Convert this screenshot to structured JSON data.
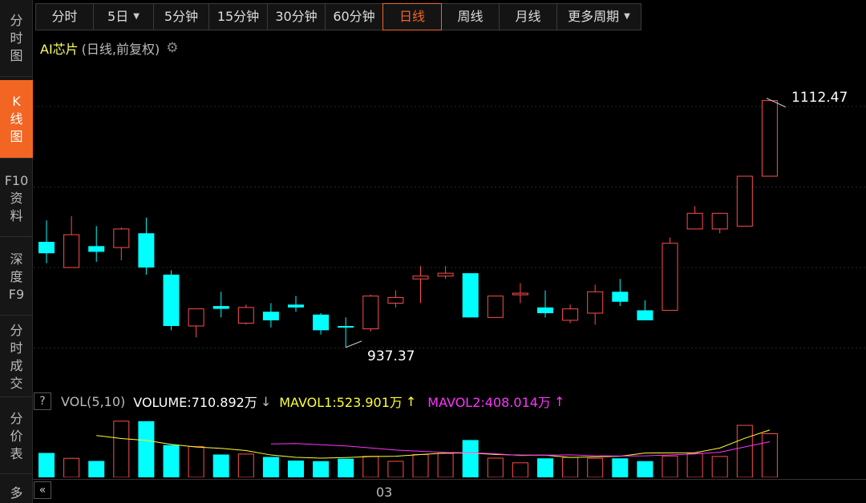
{
  "sidebar": {
    "items": [
      {
        "label": [
          "分",
          "时",
          "图"
        ],
        "active": false
      },
      {
        "label": [
          "K",
          "线",
          "图"
        ],
        "active": true
      },
      {
        "label": [
          "F10",
          "资",
          "料"
        ],
        "active": false
      },
      {
        "label": [
          "深",
          "度",
          "F9"
        ],
        "active": false
      },
      {
        "label": [
          "分",
          "时",
          "成",
          "交"
        ],
        "active": false
      },
      {
        "label": [
          "分",
          "价",
          "表"
        ],
        "active": false
      },
      {
        "label": [
          "多"
        ],
        "active": false
      }
    ]
  },
  "toolbar": {
    "tabs": [
      {
        "label": "分时",
        "dropdown": false
      },
      {
        "label": "5日",
        "dropdown": true
      },
      {
        "label": "5分钟",
        "dropdown": false
      },
      {
        "label": "15分钟",
        "dropdown": false
      },
      {
        "label": "30分钟",
        "dropdown": false
      },
      {
        "label": "60分钟",
        "dropdown": false
      },
      {
        "label": "日线",
        "dropdown": false,
        "active": true
      },
      {
        "label": "周线",
        "dropdown": false
      },
      {
        "label": "月线",
        "dropdown": false
      },
      {
        "label": "更多周期",
        "dropdown": true
      }
    ]
  },
  "chart_title": {
    "name": "AI芯片",
    "meta": "(日线,前复权)",
    "settings_icon": "gear-icon"
  },
  "price_annotations": {
    "high": "1112.47",
    "low": "937.37"
  },
  "volume_panel": {
    "help": "?",
    "label": "VOL(5,10)",
    "volume": "VOLUME:710.892万",
    "volume_arrow": "↓",
    "mavol1": "MAVOL1:523.901万",
    "mavol1_arrow": "↑",
    "mavol2": "MAVOL2:408.014万",
    "mavol2_arrow": "↑"
  },
  "x_axis": {
    "tick_label": "03"
  },
  "collapse_button": "«",
  "colors": {
    "up": "#ff4d4d",
    "down": "#00ffff",
    "ma1": "#ffff33",
    "ma2": "#ff33ff",
    "accent": "#f26522"
  },
  "chart_data": {
    "type": "candlestick",
    "price_ylim": [
      922,
      1132
    ],
    "candles": [
      {
        "o": 1013,
        "c": 1005,
        "h": 1028,
        "l": 998,
        "v": 263,
        "dir": "down"
      },
      {
        "o": 995,
        "c": 1018,
        "h": 1031,
        "l": 995,
        "v": 205,
        "dir": "up"
      },
      {
        "o": 1010,
        "c": 1006,
        "h": 1024,
        "l": 999,
        "v": 177,
        "dir": "down"
      },
      {
        "o": 1009,
        "c": 1022,
        "h": 1023,
        "l": 1000,
        "v": 605,
        "dir": "up"
      },
      {
        "o": 1019,
        "c": 995,
        "h": 1030,
        "l": 990,
        "v": 605,
        "dir": "down"
      },
      {
        "o": 990,
        "c": 954,
        "h": 993,
        "l": 951,
        "v": 348,
        "dir": "down"
      },
      {
        "o": 954,
        "c": 966,
        "h": 966,
        "l": 946,
        "v": 333,
        "dir": "up"
      },
      {
        "o": 968,
        "c": 966,
        "h": 978,
        "l": 960,
        "v": 246,
        "dir": "down"
      },
      {
        "o": 956,
        "c": 967,
        "h": 969,
        "l": 955,
        "v": 251,
        "dir": "up"
      },
      {
        "o": 964,
        "c": 958,
        "h": 970,
        "l": 953,
        "v": 220,
        "dir": "down"
      },
      {
        "o": 969,
        "c": 967,
        "h": 975,
        "l": 964,
        "v": 181,
        "dir": "down"
      },
      {
        "o": 962,
        "c": 951,
        "h": 963,
        "l": 948,
        "v": 175,
        "dir": "down"
      },
      {
        "o": 954,
        "c": 953,
        "h": 960,
        "l": 939,
        "v": 201,
        "dir": "down"
      },
      {
        "o": 952,
        "c": 975,
        "h": 976,
        "l": 950,
        "v": 227,
        "dir": "up"
      },
      {
        "o": 970,
        "c": 974,
        "h": 979,
        "l": 967,
        "v": 173,
        "dir": "up"
      },
      {
        "o": 987,
        "c": 989,
        "h": 996,
        "l": 970,
        "v": 246,
        "dir": "up"
      },
      {
        "o": 989,
        "c": 991,
        "h": 996,
        "l": 987,
        "v": 258,
        "dir": "up"
      },
      {
        "o": 991,
        "c": 960,
        "h": 991,
        "l": 960,
        "v": 402,
        "dir": "down"
      },
      {
        "o": 960,
        "c": 975,
        "h": 975,
        "l": 960,
        "v": 207,
        "dir": "up"
      },
      {
        "o": 976,
        "c": 977,
        "h": 984,
        "l": 970,
        "v": 157,
        "dir": "up"
      },
      {
        "o": 967,
        "c": 963,
        "h": 979,
        "l": 960,
        "v": 205,
        "dir": "down"
      },
      {
        "o": 958,
        "c": 966,
        "h": 969,
        "l": 956,
        "v": 215,
        "dir": "up"
      },
      {
        "o": 963,
        "c": 978,
        "h": 983,
        "l": 955,
        "v": 205,
        "dir": "up"
      },
      {
        "o": 978,
        "c": 971,
        "h": 987,
        "l": 968,
        "v": 205,
        "dir": "down"
      },
      {
        "o": 965,
        "c": 958,
        "h": 972,
        "l": 958,
        "v": 175,
        "dir": "down"
      },
      {
        "o": 965,
        "c": 1012,
        "h": 1016,
        "l": 965,
        "v": 230,
        "dir": "up"
      },
      {
        "o": 1022,
        "c": 1033,
        "h": 1038,
        "l": 1022,
        "v": 258,
        "dir": "up"
      },
      {
        "o": 1022,
        "c": 1033,
        "h": 1033,
        "l": 1019,
        "v": 225,
        "dir": "up"
      },
      {
        "o": 1024,
        "c": 1059,
        "h": 1059,
        "l": 1024,
        "v": 560,
        "dir": "up"
      },
      {
        "o": 1059,
        "c": 1112,
        "h": 1112,
        "l": 1059,
        "v": 470,
        "dir": "up"
      }
    ],
    "vol_ylim": [
      0,
      690
    ],
    "mavol1_start": 2,
    "mavol1": [
      412,
      454,
      451,
      418,
      398,
      356,
      327,
      313,
      289,
      241,
      216,
      207,
      213,
      224,
      228,
      246,
      262,
      262,
      247,
      239,
      239,
      215,
      221,
      227,
      262,
      264,
      265,
      316,
      421,
      510
    ],
    "mavol2_start": 9,
    "mavol2": [
      0,
      0,
      0,
      0,
      0,
      0,
      0,
      0,
      0,
      360,
      364,
      352,
      339,
      317,
      294,
      281,
      268,
      265,
      254,
      235,
      239,
      243,
      233,
      230,
      232,
      242,
      252,
      271,
      328,
      384
    ]
  }
}
